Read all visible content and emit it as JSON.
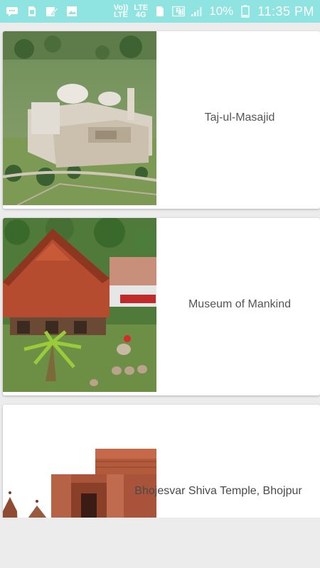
{
  "status_bar": {
    "volte": "Vo))\nLTE",
    "lte": "LTE\n4G",
    "signal_r": "R",
    "battery_pct": "10%",
    "time": "11:35 PM",
    "icons": [
      "message-icon",
      "sim-icon",
      "edit-icon",
      "image-icon",
      "signal-icon",
      "battery-icon"
    ]
  },
  "places": [
    {
      "name": "Taj-ul-Masajid"
    },
    {
      "name": "Museum of Mankind"
    },
    {
      "name": "Bhojesvar Shiva Temple, Bhojpur"
    }
  ],
  "colors": {
    "statusbar": "#8fe3e0",
    "background": "#ececec",
    "card": "#ffffff",
    "title": "#555555"
  }
}
